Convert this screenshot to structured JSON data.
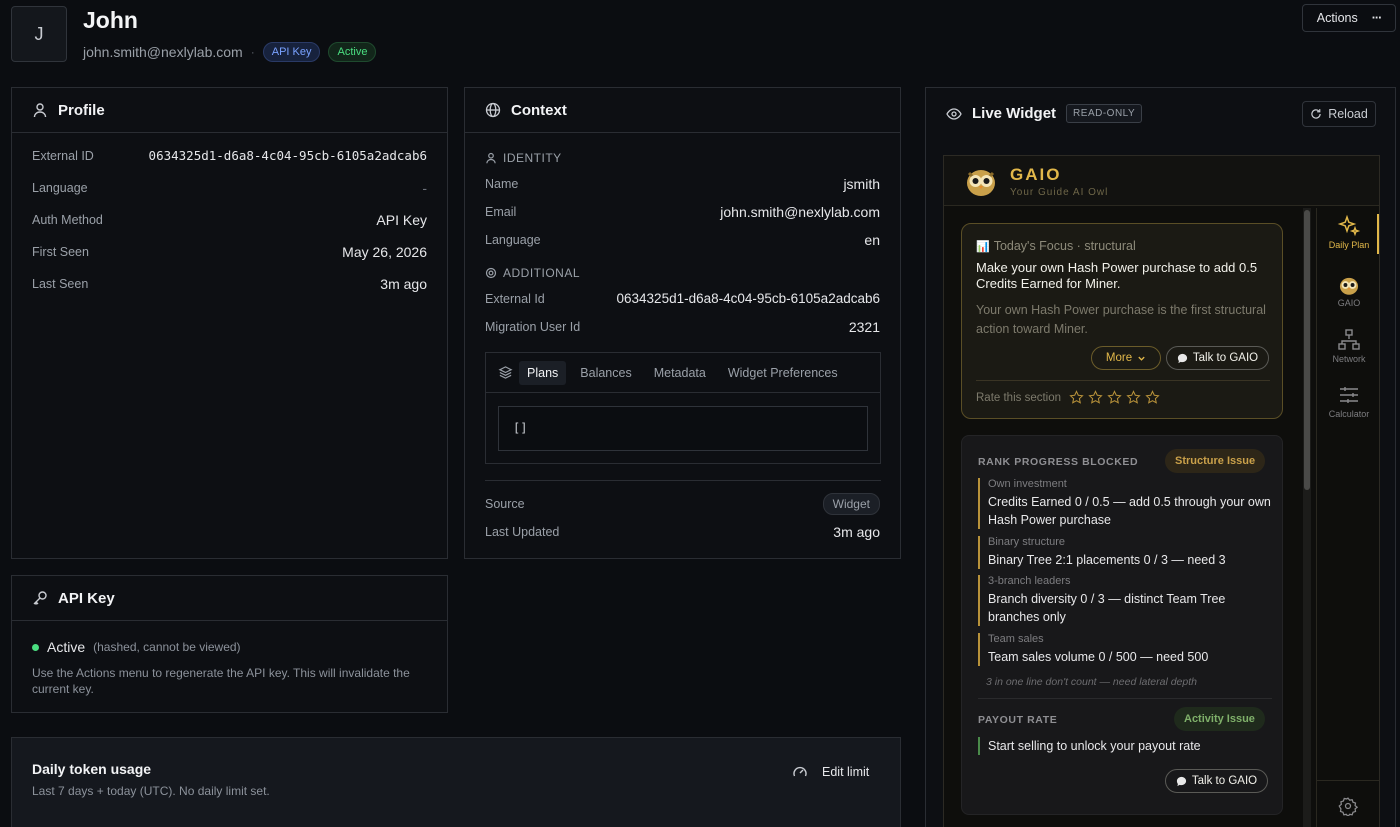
{
  "header": {
    "avatar_letter": "J",
    "name": "John",
    "email": "john.smith@nexlylab.com",
    "separator": "·",
    "badge_apikey": "API Key",
    "badge_active": "Active",
    "actions_label": "Actions",
    "actions_more": "···"
  },
  "profile": {
    "title": "Profile",
    "rows": [
      {
        "k": "External ID",
        "v": "0634325d1-d6a8-4c04-95cb-6105a2adcab6"
      },
      {
        "k": "Language",
        "v": "-"
      },
      {
        "k": "Auth Method",
        "v": "API Key"
      },
      {
        "k": "First Seen",
        "v": "May 26, 2026"
      },
      {
        "k": "Last Seen",
        "v": "3m ago"
      }
    ]
  },
  "apikey": {
    "title": "API Key",
    "status": "Active",
    "note": "(hashed, cannot be viewed)",
    "help": "Use the Actions menu to regenerate the API key. This will invalidate the current key."
  },
  "usage": {
    "title": "Daily token usage",
    "subtitle": "Last 7 days + today (UTC). No daily limit set.",
    "edit_label": "Edit limit"
  },
  "context": {
    "title": "Context",
    "identity_label": "IDENTITY",
    "identity": [
      {
        "k": "Name",
        "v": "jsmith"
      },
      {
        "k": "Email",
        "v": "john.smith@nexlylab.com"
      },
      {
        "k": "Language",
        "v": "en"
      }
    ],
    "additional_label": "ADDITIONAL",
    "additional": [
      {
        "k": "External Id",
        "v": "0634325d1-d6a8-4c04-95cb-6105a2adcab6"
      },
      {
        "k": "Migration User Id",
        "v": "2321"
      }
    ],
    "tabs": [
      "Plans",
      "Balances",
      "Metadata",
      "Widget Preferences"
    ],
    "active_tab": "Plans",
    "code": "[]",
    "source_label": "Source",
    "source_value": "Widget",
    "updated_label": "Last Updated",
    "updated_value": "3m ago"
  },
  "widget": {
    "title": "Live Widget",
    "readonly": "READ-ONLY",
    "reload": "Reload",
    "brand": "GAIO",
    "tagline": "Your Guide AI Owl",
    "focus": {
      "icon": "📊",
      "header": "Today's Focus · structural",
      "headline": "Make your own Hash Power purchase to add 0.5 Credits Earned for Miner.",
      "body": "Your own Hash Power purchase is the first structural action toward Miner.",
      "more": "More",
      "talk": "Talk to GAIO",
      "rate": "Rate this section",
      "stars": 0
    },
    "rank": {
      "title": "RANK PROGRESS BLOCKED",
      "tag": "Structure Issue",
      "items": [
        {
          "label": "Own investment",
          "text": "Credits Earned 0 / 0.5 — add 0.5 through your own Hash Power purchase"
        },
        {
          "label": "Binary structure",
          "text": "Binary Tree 2:1 placements 0 / 3 — need 3"
        },
        {
          "label": "3-branch leaders",
          "text": "Branch diversity 0 / 3 — distinct Team Tree branches only"
        },
        {
          "label": "Team sales",
          "text": "Team sales volume 0 / 500 — need 500"
        }
      ],
      "note": "3 in one line don't count — need lateral depth"
    },
    "payout": {
      "title": "PAYOUT RATE",
      "tag": "Activity Issue",
      "text": "Start selling to unlock your payout rate",
      "talk": "Talk to GAIO"
    },
    "nav": [
      {
        "label": "Daily Plan",
        "icon": "sparkles-icon"
      },
      {
        "label": "GAIO",
        "icon": "owl-icon"
      },
      {
        "label": "Network",
        "icon": "network-icon"
      },
      {
        "label": "Calculator",
        "icon": "sliders-icon"
      }
    ]
  },
  "colors": {
    "accent_gold": "#e2b84a",
    "active_green": "#4ade80",
    "apikey_blue": "#7aa2ff"
  }
}
